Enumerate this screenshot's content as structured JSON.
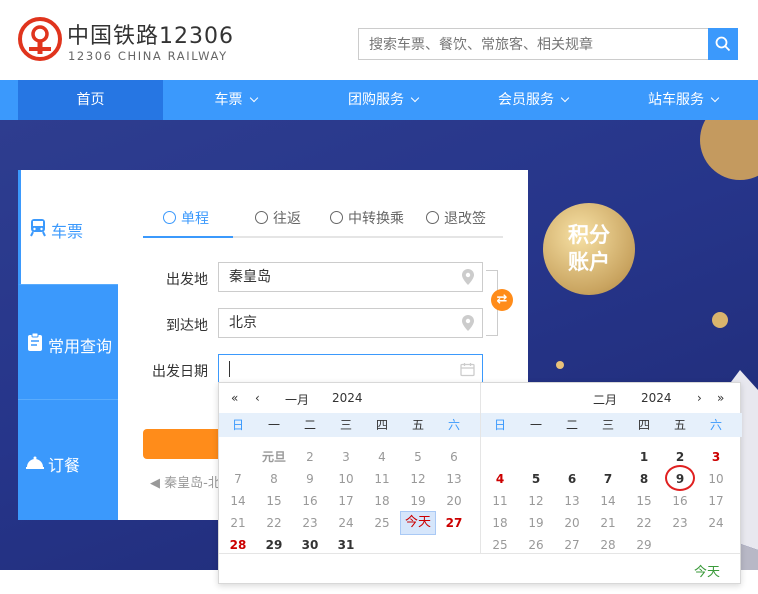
{
  "header": {
    "logo_cn": "中国铁路12306",
    "logo_en": "12306 CHINA RAILWAY",
    "search_placeholder": "搜索车票、餐饮、常旅客、相关规章"
  },
  "nav": {
    "items": [
      {
        "label": "首页"
      },
      {
        "label": "车票"
      },
      {
        "label": "团购服务"
      },
      {
        "label": "会员服务"
      },
      {
        "label": "站车服务"
      }
    ]
  },
  "banner": {
    "badge_line1": "积分",
    "badge_line2": "账户"
  },
  "side_tabs": [
    {
      "label": "车票"
    },
    {
      "label": "常用查询"
    },
    {
      "label": "订餐"
    }
  ],
  "mode_tabs": [
    {
      "label": "单程"
    },
    {
      "label": "往返"
    },
    {
      "label": "中转换乘"
    },
    {
      "label": "退改签"
    }
  ],
  "form": {
    "from_label": "出发地",
    "from_value": "秦皇岛",
    "to_label": "到达地",
    "to_value": "北京",
    "date_label": "出发日期",
    "date_value": "",
    "history": "秦皇岛-北",
    "swap_icon": "⇄"
  },
  "calendar": {
    "weekdays": [
      "日",
      "一",
      "二",
      "三",
      "四",
      "五",
      "六"
    ],
    "left": {
      "month": "一月",
      "year": "2024"
    },
    "right": {
      "month": "二月",
      "year": "2024"
    },
    "today_label": "今天",
    "holiday_label": "元旦",
    "selected_day": "9",
    "footer_today": "今天"
  },
  "colors": {
    "primary": "#3b99fc",
    "accent": "#ff8c1a",
    "holiday": "#cc0000"
  }
}
